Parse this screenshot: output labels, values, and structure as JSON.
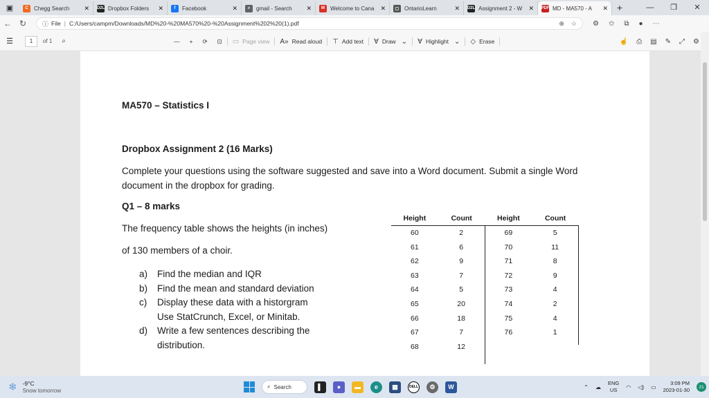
{
  "browser": {
    "tabs": [
      {
        "title": "Chegg Search",
        "icon": "chegg-icon",
        "color": "#f26b21",
        "glyph": "C",
        "active": false
      },
      {
        "title": "Dropbox Folders",
        "icon": "d2l-icon",
        "color": "#222222",
        "glyph": "D2L",
        "active": false
      },
      {
        "title": "Facebook",
        "icon": "facebook-icon",
        "color": "#1877f2",
        "glyph": "f",
        "active": false
      },
      {
        "title": "gmail - Search",
        "icon": "search-icon",
        "color": "#5f6368",
        "glyph": "⌕",
        "active": false
      },
      {
        "title": "Welcome to Cana",
        "icon": "gmail-icon",
        "color": "#d93025",
        "glyph": "M",
        "active": false
      },
      {
        "title": "OntarioLearn",
        "icon": "document-icon",
        "color": "#555555",
        "glyph": "▢",
        "active": false
      },
      {
        "title": "Assignment 2 - W",
        "icon": "d2l-icon",
        "color": "#222222",
        "glyph": "D2L",
        "active": false
      },
      {
        "title": "MD - MA570 - A",
        "icon": "pdf-icon",
        "color": "#c5221f",
        "glyph": "PDF",
        "active": true
      }
    ],
    "url_scheme": "File",
    "url": "C:/Users/campm/Downloads/MD%20-%20MA570%20-%20Assignment%202%20(1).pdf"
  },
  "pdf_toolbar": {
    "page_current": "1",
    "page_total": "of 1",
    "page_view": "Page view",
    "read_aloud": "Read aloud",
    "add_text": "Add text",
    "draw": "Draw",
    "highlight": "Highlight",
    "erase": "Erase"
  },
  "document": {
    "course": "MA570 – Statistics I",
    "heading": "Dropbox Assignment 2 (16 Marks)",
    "instructions": "Complete your questions using the software suggested and save into a Word document. Submit a single Word document in the dropbox for grading.",
    "question_heading": "Q1 – 8 marks",
    "desc_line1": "The frequency table shows the heights (in inches)",
    "desc_line2": "of 130 members of a choir.",
    "tasks": [
      {
        "label": "a)",
        "text": "Find the median and IQR"
      },
      {
        "label": "b)",
        "text": "Find the mean and standard deviation"
      },
      {
        "label": "c)",
        "text": "Display these data with a historgram Use StatCrunch, Excel, or Minitab."
      },
      {
        "label": "d)",
        "text": "Write a few sentences describing the distribution."
      }
    ],
    "table": {
      "headers": [
        "Height",
        "Count",
        "Height",
        "Count"
      ],
      "left_heights": [
        "60",
        "61",
        "62",
        "63",
        "64",
        "65",
        "66",
        "67",
        "68"
      ],
      "left_counts": [
        "2",
        "6",
        "9",
        "7",
        "5",
        "20",
        "18",
        "7",
        "12"
      ],
      "right_heights": [
        "69",
        "70",
        "71",
        "72",
        "73",
        "74",
        "75",
        "76"
      ],
      "right_counts": [
        "5",
        "11",
        "8",
        "9",
        "4",
        "2",
        "4",
        "1"
      ]
    }
  },
  "taskbar": {
    "temperature": "-9°C",
    "weather": "Snow tomorrow",
    "search": "Search",
    "lang_line1": "ENG",
    "lang_line2": "US",
    "time": "3:09 PM",
    "date": "2023-01-30",
    "notification_count": "21"
  }
}
